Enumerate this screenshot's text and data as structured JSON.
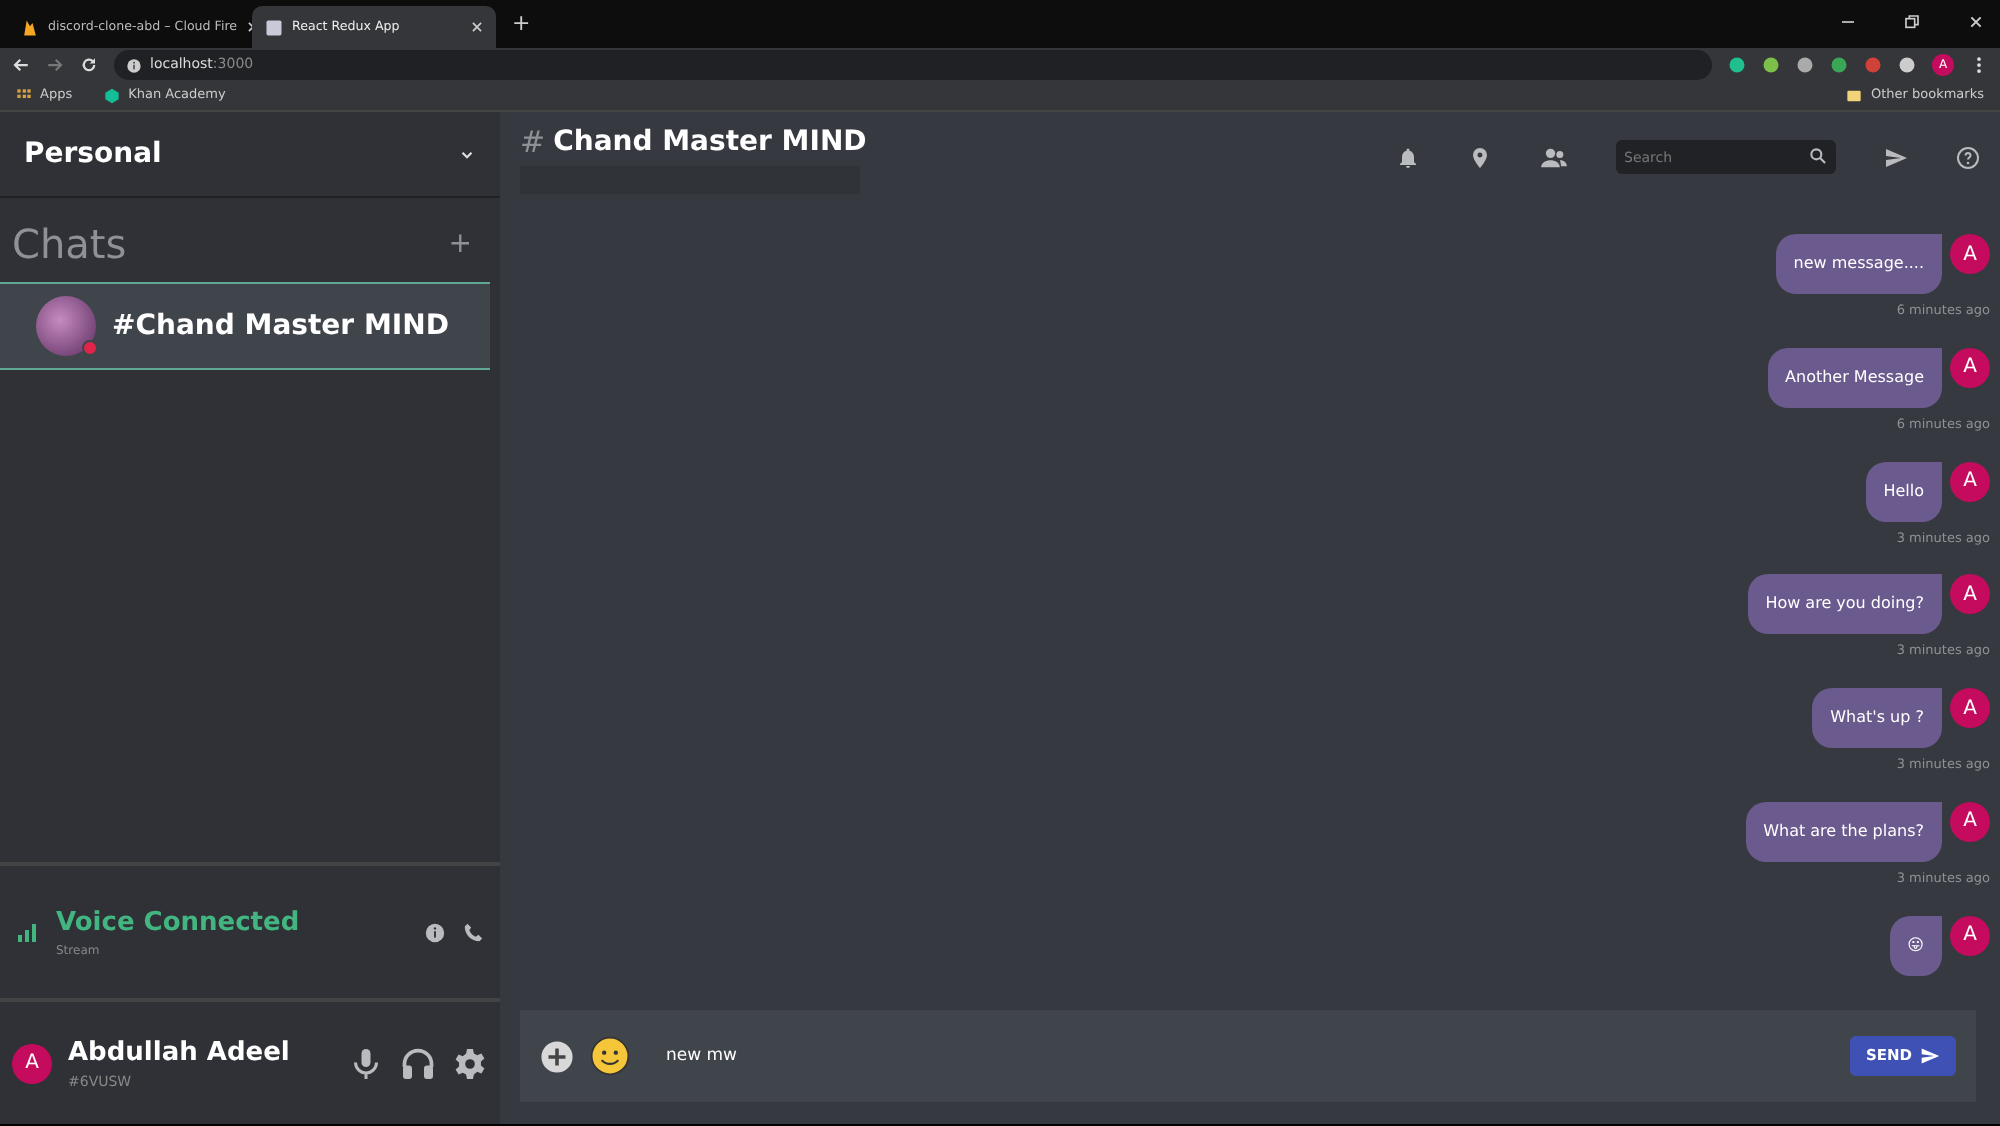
{
  "browser": {
    "tabs": [
      {
        "title": "discord-clone-abd – Cloud Fire",
        "selected": false,
        "kind": "fire"
      },
      {
        "title": "React Redux App",
        "selected": true,
        "kind": "page"
      }
    ],
    "new_tab": "+",
    "address": {
      "host": "localhost",
      "port": ":3000"
    },
    "bookmarks": [
      {
        "label": "Apps",
        "kind": "apps"
      },
      {
        "label": "Khan Academy",
        "kind": "khan"
      }
    ],
    "other_bookmarks": "Other bookmarks",
    "profile_initial": "A"
  },
  "sidebar": {
    "server": "Personal",
    "section": "Chats",
    "add": "+",
    "channels": [
      {
        "name": "#Chand Master MIND",
        "selected": true
      }
    ],
    "voice": {
      "status": "Voice Connected",
      "detail": "Stream"
    },
    "user": {
      "initial": "A",
      "name": "Abdullah Adeel",
      "tag": "#6VUSW"
    }
  },
  "chat": {
    "hash": "#",
    "title": "Chand Master MIND",
    "search": {
      "placeholder": "Search"
    },
    "messages": [
      {
        "text": "new message....",
        "time": "6 minutes ago",
        "avatar": "A"
      },
      {
        "text": "Another Message",
        "time": "6 minutes ago",
        "avatar": "A"
      },
      {
        "text": "Hello",
        "time": "3 minutes ago",
        "avatar": "A"
      },
      {
        "text": "How are you doing?",
        "time": "3 minutes ago",
        "avatar": "A"
      },
      {
        "text": "What's up ?",
        "time": "3 minutes ago",
        "avatar": "A"
      },
      {
        "text": "What are the plans?",
        "time": "3 minutes ago",
        "avatar": "A"
      },
      {
        "text": "😛",
        "avatar": "A"
      }
    ],
    "input": {
      "value": "new mw"
    },
    "send": "SEND"
  }
}
